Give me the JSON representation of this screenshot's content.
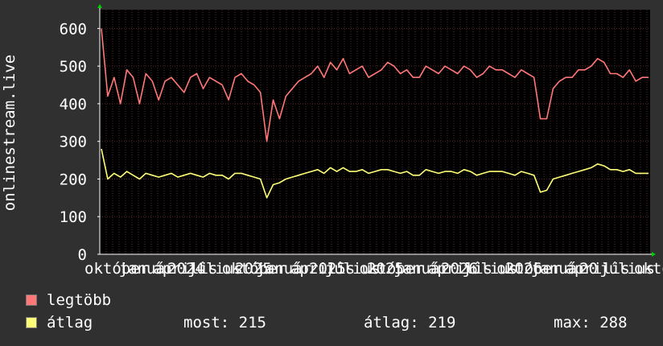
{
  "chart_data": {
    "type": "line",
    "ylabel": "onlinestream.live",
    "ylim": [
      0,
      650
    ],
    "yticks": [
      0,
      100,
      200,
      300,
      400,
      500,
      600
    ],
    "xticks": [
      "október",
      "január",
      "április",
      "július",
      "október",
      "január",
      "április",
      "július",
      "október",
      "január",
      "április",
      "július",
      "október",
      "január",
      "április",
      "július",
      "október",
      "2024",
      "2025",
      "2025",
      "2025",
      "2026",
      "2026",
      "20"
    ],
    "series": [
      {
        "name": "legtöbb",
        "color": "#ff7777",
        "values": [
          600,
          420,
          470,
          400,
          490,
          470,
          400,
          480,
          460,
          410,
          460,
          470,
          450,
          430,
          470,
          480,
          440,
          470,
          460,
          450,
          410,
          470,
          480,
          460,
          450,
          430,
          300,
          410,
          360,
          420,
          440,
          460,
          470,
          480,
          500,
          470,
          510,
          490,
          520,
          480,
          490,
          500,
          470,
          480,
          490,
          510,
          500,
          480,
          490,
          470,
          470,
          500,
          490,
          480,
          500,
          490,
          480,
          500,
          490,
          470,
          480,
          500,
          490,
          490,
          480,
          470,
          490,
          480,
          470,
          360,
          360,
          440,
          460,
          470,
          470,
          490,
          490,
          500,
          520,
          510,
          480,
          480,
          470,
          490,
          460,
          470,
          470
        ],
        "label": "legtöbb"
      },
      {
        "name": "átlag",
        "color": "#ffff77",
        "values": [
          280,
          200,
          215,
          205,
          220,
          210,
          200,
          215,
          210,
          205,
          210,
          215,
          205,
          210,
          215,
          210,
          205,
          215,
          210,
          210,
          200,
          215,
          215,
          210,
          205,
          200,
          150,
          185,
          190,
          200,
          205,
          210,
          215,
          220,
          225,
          215,
          230,
          220,
          230,
          220,
          220,
          225,
          215,
          220,
          225,
          225,
          220,
          215,
          220,
          210,
          210,
          225,
          220,
          215,
          220,
          220,
          215,
          225,
          220,
          210,
          215,
          220,
          220,
          220,
          215,
          210,
          220,
          215,
          210,
          165,
          170,
          200,
          205,
          210,
          215,
          220,
          225,
          230,
          240,
          235,
          225,
          225,
          220,
          225,
          215,
          215,
          215
        ],
        "label": "átlag"
      }
    ]
  },
  "legend": {
    "items": [
      {
        "label": "legtöbb",
        "color": "#ff7777"
      },
      {
        "label": "átlag",
        "color": "#ffff77"
      }
    ],
    "stats": {
      "most": "most: 215",
      "atlag": "átlag: 219",
      "max": "max: 288"
    }
  },
  "colors": {
    "background": "#303030",
    "plot_background": "#000000",
    "grid": "#5a2a2a",
    "axis": "#ffffff",
    "arrow": "#00cc00",
    "text": "#ffffff"
  }
}
